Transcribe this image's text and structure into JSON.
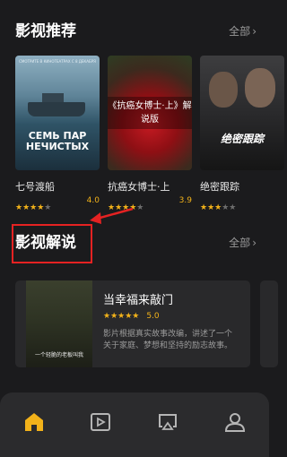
{
  "recommend": {
    "title": "影视推荐",
    "more": "全部",
    "movies": [
      {
        "title": "七号渡船",
        "score": "4.0",
        "stars": 4,
        "poster_top": "СМОТРИТЕ В КИНОТЕАТРАХ С 8 ДЕКАБРЯ",
        "poster_title": "СЕМЬ ПАР НЕЧИСТЫХ"
      },
      {
        "title": "抗癌女博士·上",
        "score": "3.9",
        "stars": 4,
        "poster_title": "《抗癌女博士·上》解说版"
      },
      {
        "title": "绝密跟踪",
        "score": "",
        "stars": 3,
        "poster_title": "绝密跟踪"
      }
    ]
  },
  "explain": {
    "title": "影视解说",
    "more": "全部",
    "card": {
      "title": "当幸福来敲门",
      "score": "5.0",
      "stars": 5,
      "desc": "影片根据真实故事改编，讲述了一个关于家庭、梦想和坚持的励志故事。",
      "thumb_sub": "一个轻脆的老板叫我"
    }
  },
  "nav": [
    "home-icon",
    "play-icon",
    "airplay-icon",
    "profile-icon"
  ],
  "colors": {
    "accent": "#f2b21a",
    "highlight": "#e52222",
    "background": "#1b1b1d",
    "card": "#29292b"
  }
}
